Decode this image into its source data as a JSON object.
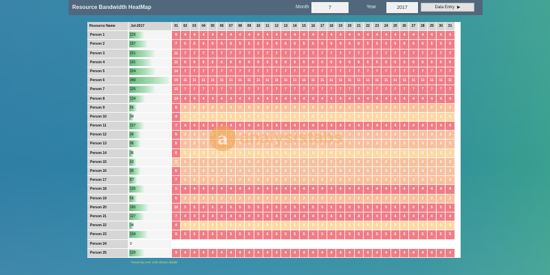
{
  "header": {
    "title": "Resource Bandwidth HeatMap",
    "month_label": "Month",
    "month_value": "7",
    "year_label": "Year",
    "year_value": "2017",
    "data_entry_label": "Data Entry"
  },
  "table": {
    "col_name": "Resource Name",
    "col_period": "Jul-2017",
    "days": [
      "01",
      "02",
      "03",
      "04",
      "05",
      "06",
      "07",
      "08",
      "09",
      "10",
      "11",
      "12",
      "13",
      "14",
      "15",
      "16",
      "17",
      "18",
      "19",
      "20",
      "21",
      "22",
      "23",
      "24",
      "25",
      "26",
      "27",
      "28",
      "29",
      "30",
      "31"
    ],
    "rows": [
      {
        "name": "Person 1",
        "total": 129,
        "first": 9,
        "daily": 4
      },
      {
        "name": "Person 2",
        "total": 157,
        "first": 7,
        "daily": 5
      },
      {
        "name": "Person 3",
        "total": 221,
        "first": 11,
        "daily": 7
      },
      {
        "name": "Person 4",
        "total": 191,
        "first": 11,
        "daily": 6
      },
      {
        "name": "Person 5",
        "total": 224,
        "first": 14,
        "daily": 7
      },
      {
        "name": "Person 6",
        "total": 349,
        "first": 19,
        "daily": 11
      },
      {
        "name": "Person 7",
        "total": 225,
        "first": 15,
        "daily": 7
      },
      {
        "name": "Person 8",
        "total": 134,
        "first": 14,
        "daily": 4
      },
      {
        "name": "Person 9",
        "total": 66,
        "first": 6,
        "daily": 2
      },
      {
        "name": "Person 10",
        "total": 34,
        "first": 4,
        "daily": 1
      },
      {
        "name": "Person 11",
        "total": 127,
        "first": 7,
        "daily": 4
      },
      {
        "name": "Person 12",
        "total": 96,
        "first": 6,
        "daily": 3
      },
      {
        "name": "Person 13",
        "total": 96,
        "first": 6,
        "daily": 3
      },
      {
        "name": "Person 14",
        "total": 36,
        "first": 6,
        "daily": 1
      },
      {
        "name": "Person 15",
        "total": 62,
        "first": 2,
        "daily": 2
      },
      {
        "name": "Person 16",
        "total": 96,
        "first": 6,
        "daily": 3
      },
      {
        "name": "Person 17",
        "total": 67,
        "first": 7,
        "daily": 2
      },
      {
        "name": "Person 18",
        "total": 125,
        "first": 5,
        "daily": 4
      },
      {
        "name": "Person 19",
        "total": 66,
        "first": 6,
        "daily": 2
      },
      {
        "name": "Person 20",
        "total": 160,
        "first": 10,
        "daily": 5
      },
      {
        "name": "Person 21",
        "total": 127,
        "first": 7,
        "daily": 4
      },
      {
        "name": "Person 22",
        "total": 34,
        "first": 4,
        "daily": 1
      },
      {
        "name": "Person 23",
        "total": 159,
        "first": 9,
        "daily": 5
      },
      {
        "name": "Person 24",
        "total": 0,
        "first": null,
        "daily": null
      },
      {
        "name": "Person 25",
        "total": 129,
        "first": 9,
        "daily": 4
      }
    ]
  },
  "heat_colors": {
    "high": "#f07d86",
    "mid": "#f7c09e",
    "low": "#fbd9a5",
    "empty": "#ffffff"
  },
  "watermark": {
    "mark": "a",
    "text": "analysistabs"
  },
  "footnote": "*Hovering over cells shows details"
}
